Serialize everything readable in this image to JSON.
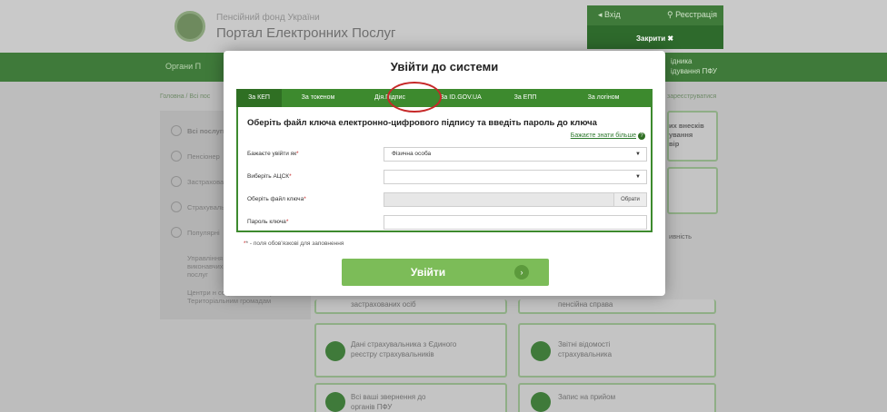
{
  "background": {
    "org_name": "Пенсійний фонд України",
    "portal_name": "Портал Електронних Послуг",
    "login_link": "Вхід",
    "register_link": "Реєстрація",
    "close_label": "Закрити ✖",
    "nav_left": "Органи П",
    "nav_right": "ідника\nідування ПФУ",
    "breadcrumb": "Головна / Всі пос",
    "breadcrumb_right": "зареєструватися",
    "sidebar_items": [
      "Всі послуги",
      "Пенсіонер",
      "Застрахован",
      "Страхуваль",
      "Популярні",
      "Управління виконавчих послуг",
      "Центри н соціальних послуг Територіальним громадам"
    ],
    "right_texts": [
      "их внесків",
      "ування",
      "вір",
      "ивність"
    ],
    "cards": [
      {
        "text": "Дані страхувальника з Єдиного реєстру страхувальників"
      },
      {
        "text": "Звітні відомості страхувальника"
      },
      {
        "text": "Всі ваші звернення до органів ПФУ"
      },
      {
        "text": "Запис на прийом"
      },
      {
        "text": "застрахованих осіб"
      },
      {
        "text": "пенсійна справа"
      }
    ]
  },
  "modal": {
    "title": "Увійти до системи",
    "tabs": [
      {
        "label": "За КЕП",
        "active": true
      },
      {
        "label": "За токеном",
        "active": false
      },
      {
        "label": "Дія.Підпис",
        "active": false
      },
      {
        "label": "За ID.GOV.UA",
        "active": false
      },
      {
        "label": "За ЕПП",
        "active": false
      },
      {
        "label": "За логіном",
        "active": false
      }
    ],
    "form_heading": "Оберіть файл ключа електронно-цифрового підпису та введіть пароль до ключа",
    "more_link": "Бажаєте знати більше",
    "fields": {
      "login_as_label": "Бажаєте увійти як",
      "login_as_value": "Фізична особа",
      "acsk_label": "Виберіть АЦСК",
      "acsk_value": "",
      "key_file_label": "Оберіть файл ключа",
      "browse_label": "Обрати",
      "password_label": "Пароль ключа",
      "password_value": ""
    },
    "required_note": "* - поля обов'язкові для заповнення",
    "login_button": "Увійти"
  },
  "colors": {
    "accent_green": "#3d8a2e",
    "button_green": "#7cbc58",
    "highlight_red": "#c62828"
  }
}
